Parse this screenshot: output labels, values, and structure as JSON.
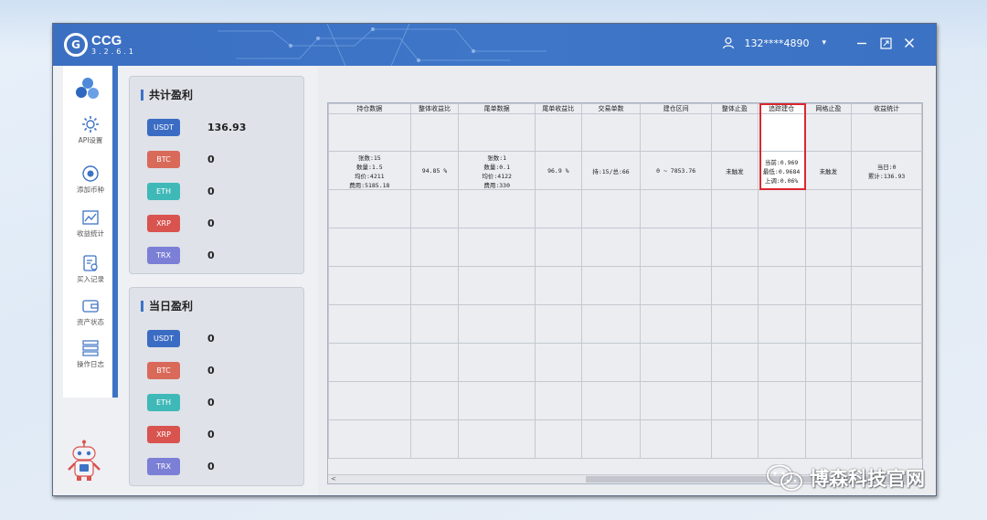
{
  "app": {
    "name": "CCG",
    "version": "3.2.6.1"
  },
  "user": {
    "name": "132****4890"
  },
  "sidebar": {
    "items": [
      {
        "label": "API设置",
        "icon": "gear-icon"
      },
      {
        "label": "添加币种",
        "icon": "add-coin-icon"
      },
      {
        "label": "收益统计",
        "icon": "chart-icon"
      },
      {
        "label": "买入记录",
        "icon": "buy-record-icon"
      },
      {
        "label": "资产状态",
        "icon": "wallet-icon"
      },
      {
        "label": "操作日志",
        "icon": "log-icon"
      }
    ]
  },
  "total_profit": {
    "title": "共计盈利",
    "coins": [
      {
        "name": "USDT",
        "value": "136.93",
        "color": "#3b6cc4"
      },
      {
        "name": "BTC",
        "value": "0",
        "color": "#d96a5a"
      },
      {
        "name": "ETH",
        "value": "0",
        "color": "#3fb8b8"
      },
      {
        "name": "XRP",
        "value": "0",
        "color": "#d9534f"
      },
      {
        "name": "TRX",
        "value": "0",
        "color": "#7b7fd6"
      }
    ]
  },
  "daily_profit": {
    "title": "当日盈利",
    "coins": [
      {
        "name": "USDT",
        "value": "0",
        "color": "#3b6cc4"
      },
      {
        "name": "BTC",
        "value": "0",
        "color": "#d96a5a"
      },
      {
        "name": "ETH",
        "value": "0",
        "color": "#3fb8b8"
      },
      {
        "name": "XRP",
        "value": "0",
        "color": "#d9534f"
      },
      {
        "name": "TRX",
        "value": "0",
        "color": "#7b7fd6"
      }
    ]
  },
  "table": {
    "headers": [
      "持仓数据",
      "整体收益比",
      "尾单数据",
      "尾单收益比",
      "交易单数",
      "建仓区间",
      "整体止盈",
      "追踪建仓",
      "网格止盈",
      "收益统计"
    ],
    "row": {
      "position": [
        "张数:15",
        "数量:1.5",
        "均价:4211",
        "费用:5185.18"
      ],
      "overall_ratio": "94.85 %",
      "tail": [
        "张数:1",
        "数量:0.1",
        "均价:4122",
        "费用:330"
      ],
      "tail_ratio": "96.9 %",
      "trades": "持:15/总:66",
      "range": "0 ~ 7853.76",
      "overall_tp": "未触发",
      "trailing": [
        "当前:0.969",
        "最低:0.9684",
        "上调:0.06%"
      ],
      "grid_tp": "未触发",
      "stats": [
        "当日:0",
        "累计:136.93"
      ]
    },
    "scroll_left": "<"
  },
  "watermark": {
    "text": "博森科技官网"
  },
  "colors": {
    "accent": "#3d73c4",
    "highlight": "#d9272e"
  }
}
